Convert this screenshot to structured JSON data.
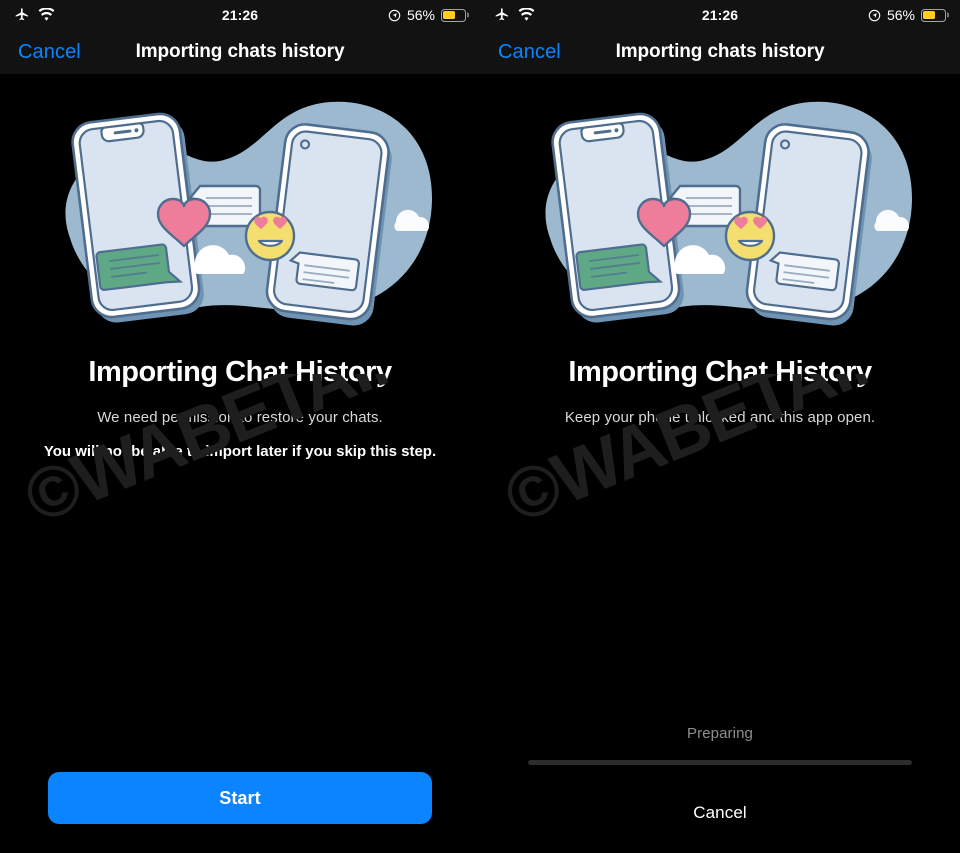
{
  "status_bar": {
    "airplane_icon": "airplane-mode-icon",
    "wifi_icon": "wifi-icon",
    "time": "21:26",
    "location_icon": "location-services-icon",
    "battery_percent": "56%",
    "battery_level": 56
  },
  "nav": {
    "cancel_label": "Cancel",
    "title": "Importing chats history"
  },
  "illustration": {
    "name": "two-phones-chat-transfer-illustration",
    "blob_color": "#9CB9CF",
    "phone_screen_color": "#D9E4F0",
    "phone_body_color": "#FFFFFF",
    "outline_color": "#4F6E8F",
    "shadow_color": "#6F93B2",
    "heart_color": "#EE7D9B",
    "emoji_color": "#F4DE6D",
    "green_bubble_color": "#5FA886",
    "cloud_color": "#FFFFFF"
  },
  "watermark": {
    "text": "©WABETAINFO",
    "color": "#1E1E1E"
  },
  "left_panel": {
    "headline": "Importing Chat History",
    "subtitle": "We need permission to restore your chats.",
    "warning": "You will not be able to import later if you skip this step.",
    "start_label": "Start",
    "start_color": "#0A84FF"
  },
  "right_panel": {
    "headline": "Importing Chat History",
    "subtitle": "Keep your phone unlocked and this app open.",
    "progress_label": "Preparing",
    "progress_percent": 0,
    "cancel_label": "Cancel"
  },
  "colors": {
    "background": "#000000",
    "bar_background": "#121212",
    "accent": "#0A84FF",
    "battery_yellow": "#FDD017",
    "secondary_text": "#8E8E93",
    "progress_track": "#2C2C2E"
  }
}
